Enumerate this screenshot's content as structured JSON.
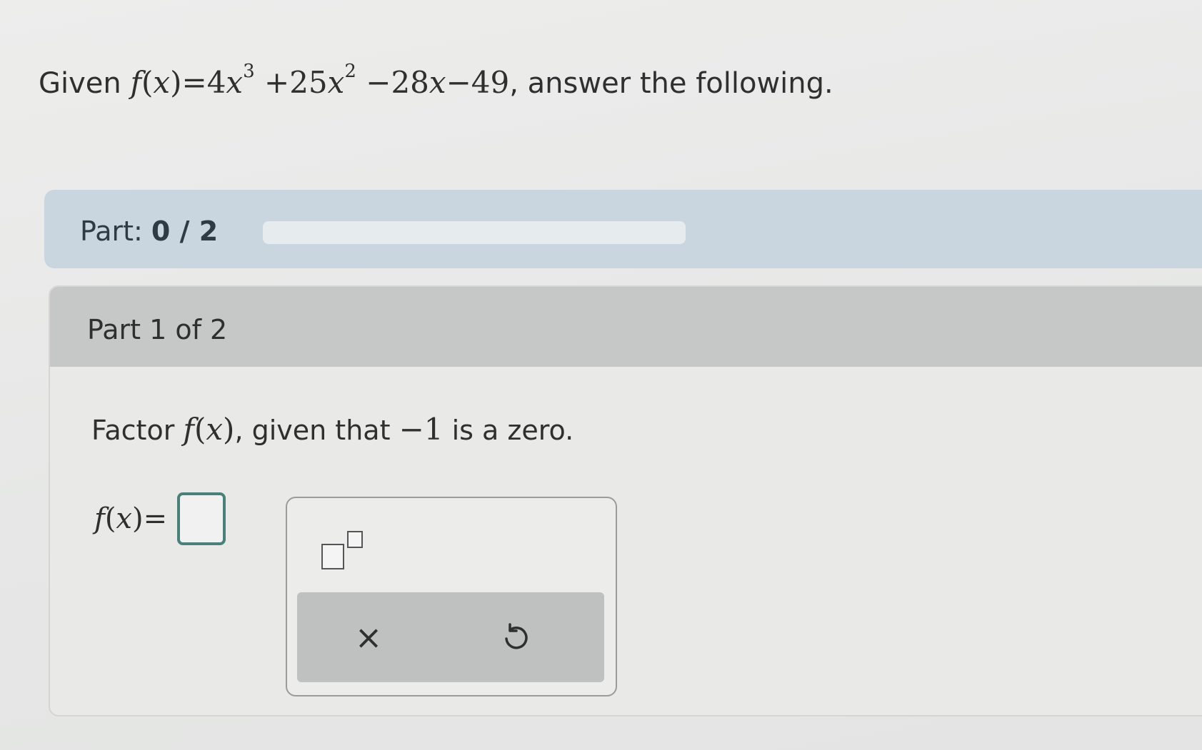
{
  "question": {
    "prefix": "Given",
    "function_name": "f",
    "variable": "x",
    "equals": "=",
    "term1_coef": "4",
    "term1_var": "x",
    "term1_exp": "3",
    "term2": "+25",
    "term2_var": "x",
    "term2_exp": "2",
    "term3": "−28",
    "term3_var": "x",
    "term4": "−49",
    "suffix": ", answer the following."
  },
  "progress": {
    "label": "Part:",
    "current": "0",
    "separator": "/",
    "total": "2",
    "fraction_complete": 0,
    "fill_color": "#3a8fc9"
  },
  "part": {
    "header": "Part 1 of 2",
    "instruction_prefix": "Factor",
    "instruction_func": "f",
    "instruction_var": "x",
    "instruction_middle": ", given that",
    "instruction_value": "−1",
    "instruction_suffix": "is a zero.",
    "answer_func": "f",
    "answer_var": "x",
    "answer_equals": "="
  },
  "keypad": {
    "exponent_button_icon": "superscript-template-icon",
    "clear_icon": "close-icon",
    "clear_glyph": "×",
    "undo_icon": "undo-icon"
  },
  "colors": {
    "progress_strip": "#c9d6df",
    "part_header": "#c6c8c7",
    "answer_box_border": "#4a7f7a"
  }
}
